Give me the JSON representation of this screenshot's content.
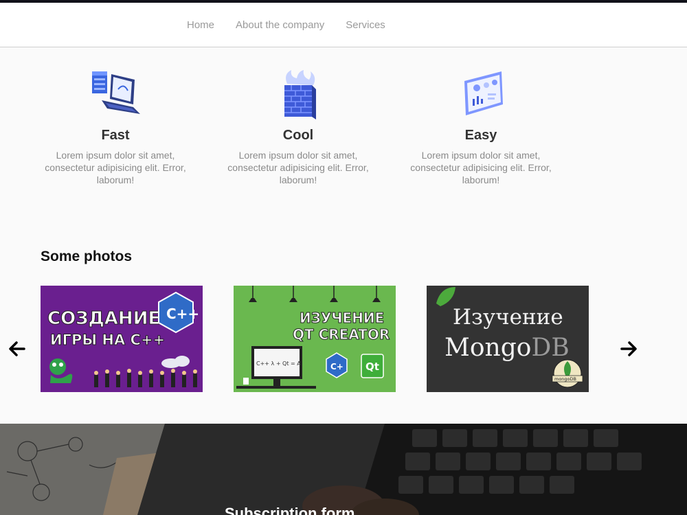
{
  "nav": {
    "items": [
      {
        "label": "Home"
      },
      {
        "label": "About the company"
      },
      {
        "label": "Services"
      }
    ]
  },
  "features": [
    {
      "icon": "server-laptop-icon",
      "title": "Fast",
      "text": "Lorem ipsum dolor sit amet, consectetur adipisicing elit. Error, laborum!"
    },
    {
      "icon": "firewall-icon",
      "title": "Cool",
      "text": "Lorem ipsum dolor sit amet, consectetur adipisicing elit. Error, laborum!"
    },
    {
      "icon": "dashboard-icon",
      "title": "Easy",
      "text": "Lorem ipsum dolor sit amet, consectetur adipisicing elit. Error, laborum!"
    }
  ],
  "photos": {
    "title": "Some photos",
    "slides": [
      {
        "line1": "СОЗДАНИЕ",
        "line2": "ИГРЫ НА С++",
        "badge": "C++",
        "bg": "#6a1f8f"
      },
      {
        "line1": "ИЗУЧЕНИЕ",
        "line2": "QT CREATOR",
        "badge": "Qt",
        "bg": "#6ab84f",
        "screen_text": "C++ λ + Qt = A"
      },
      {
        "line1": "Изучение",
        "line2a": "Mongo",
        "line2b": "DB",
        "badge": "mongoDB",
        "bg": "#333333"
      }
    ],
    "prev_icon": "arrow-left-icon",
    "next_icon": "arrow-right-icon"
  },
  "subscription": {
    "title": "Subscription form"
  },
  "colors": {
    "accent": "#3b4fd8",
    "top_bar": "#11121a"
  }
}
